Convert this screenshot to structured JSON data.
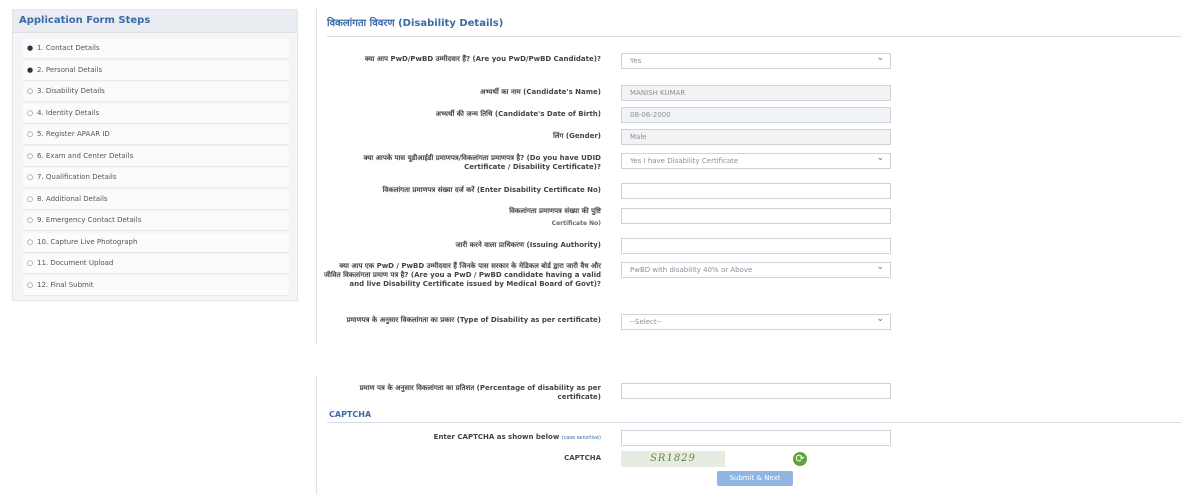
{
  "sidebar": {
    "title": "Application Form Steps",
    "steps": [
      {
        "label": "1. Contact Details",
        "icon": "check-circle-icon"
      },
      {
        "label": "2. Personal Details",
        "icon": "check-circle-icon"
      },
      {
        "label": "3. Disability Details",
        "icon": "circle-icon"
      },
      {
        "label": "4. Identity Details",
        "icon": "circle-icon"
      },
      {
        "label": "5. Register APAAR ID",
        "icon": "circle-icon"
      },
      {
        "label": "6. Exam and Center Details",
        "icon": "circle-icon"
      },
      {
        "label": "7. Qualification Details",
        "icon": "circle-icon"
      },
      {
        "label": "8. Additional Details",
        "icon": "circle-icon"
      },
      {
        "label": "9. Emergency Contact Details",
        "icon": "circle-icon"
      },
      {
        "label": "10. Capture Live Photograph",
        "icon": "circle-icon"
      },
      {
        "label": "11. Document Upload",
        "icon": "circle-icon"
      },
      {
        "label": "12. Final Submit",
        "icon": "circle-icon"
      }
    ]
  },
  "main": {
    "title": "विकलांगता विवरण (Disability Details)",
    "fields": {
      "pwd": {
        "label": "क्या आप PwD/PwBD उम्मीदवार हैं? (Are you PwD/PwBD Candidate)?",
        "value": "Yes"
      },
      "name": {
        "label": "अभ्यर्थी का नाम (Candidate's Name)",
        "value": "MANISH KUMAR"
      },
      "dob": {
        "label": "अभ्यर्थी की जन्म तिथि (Candidate's Date of Birth)",
        "value": "08-06-2000"
      },
      "gender": {
        "label": "लिंग (Gender)",
        "value": "Male"
      },
      "udid": {
        "label": "क्या आपके पास यूडीआईडी प्रमाणपत्र/विकलांगता प्रमाणपत्र है? (Do you have UDID Certificate / Disability Certificate)?",
        "value": "Yes I have Disability Certificate"
      },
      "cert_no": {
        "label": "विकलांगता प्रमाणपत्र संख्या दर्ज करें (Enter Disability Certificate No)",
        "value": ""
      },
      "cert_confirm": {
        "label": "विकलांगता प्रमाणपत्र संख्या की पुष्टि",
        "label2": "Certificate No)",
        "value": ""
      },
      "issuer": {
        "label": "जारी करने वाला प्राधिकरण (Issuing Authority)",
        "value": ""
      },
      "medical": {
        "label": "क्या आप एक PwD / PwBD उम्मीदवार हैं जिनके पास सरकार के मेडिकल बोर्ड द्वारा जारी वैध और जीवित विकलांगता प्रमाण पत्र है? (Are you a PwD / PwBD candidate having a valid and live Disability Certificate issued by Medical Board of Govt)?",
        "value": "PwBD with disability 40% or Above"
      },
      "type": {
        "label": "प्रमाणपत्र के अनुसार विकलांगता का प्रकार (Type of Disability as per certificate)",
        "value": "--Select--"
      },
      "percent": {
        "label": "प्रमाण पत्र के अनुसार विकलांगता का प्रतिशत (Percentage of disability as per certificate)",
        "value": ""
      }
    },
    "captcha": {
      "heading": "CAPTCHA",
      "enter_label": "Enter CAPTCHA as shown below",
      "case_note": "(case sensitive)",
      "captcha_label": "CAPTCHA",
      "code": "SR1829",
      "refresh_icon": "refresh-icon"
    },
    "submit_label": "Submit & Next"
  }
}
